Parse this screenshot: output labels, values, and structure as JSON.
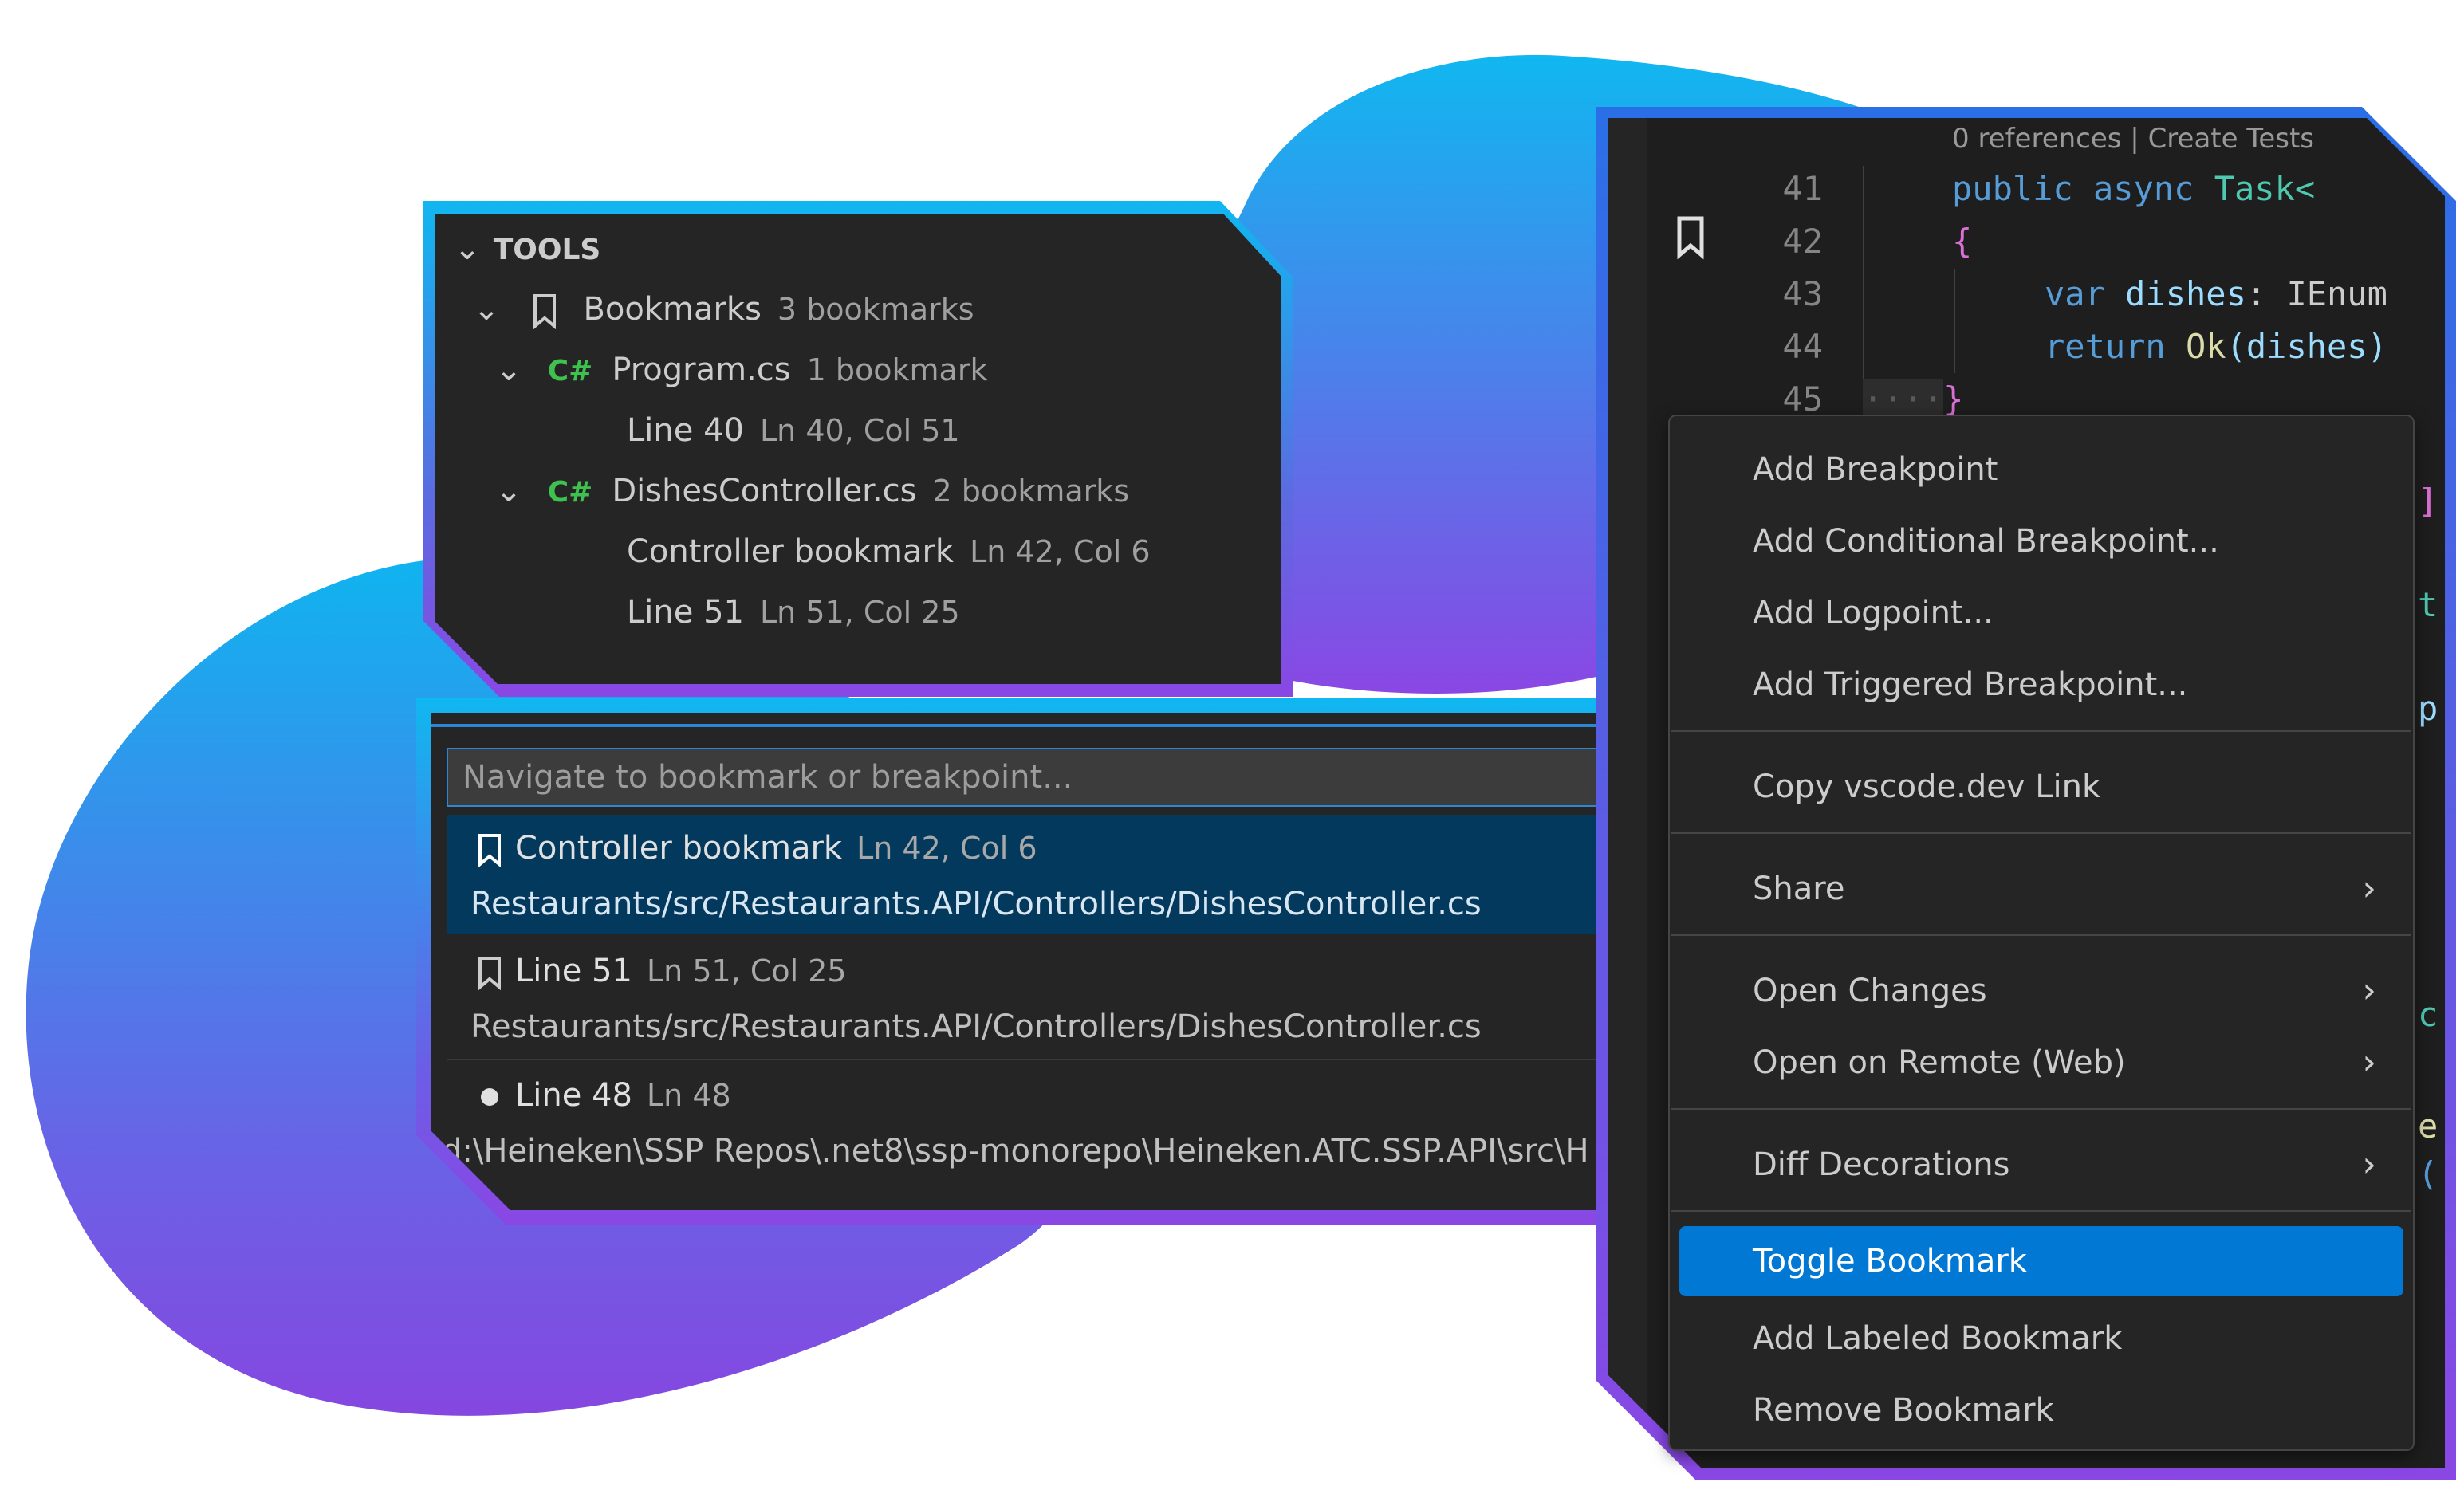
{
  "colors": {
    "accent": "#0078d4",
    "selected_row": "#04395e",
    "csharp_icon": "#3fc14f",
    "gradient_top": "#10b7f0",
    "gradient_bottom": "#8a47e4"
  },
  "tools_panel": {
    "header": "TOOLS",
    "bookmarks": {
      "label": "Bookmarks",
      "count": "3 bookmarks",
      "icon": "bookmark-icon"
    },
    "files": [
      {
        "icon": "C#",
        "name": "Program.cs",
        "count": "1 bookmark",
        "items": [
          {
            "label": "Line 40",
            "pos": "Ln 40, Col 51"
          }
        ]
      },
      {
        "icon": "C#",
        "name": "DishesController.cs",
        "count": "2 bookmarks",
        "items": [
          {
            "label": "Controller bookmark",
            "pos": "Ln 42, Col 6"
          },
          {
            "label": "Line 51",
            "pos": "Ln 51, Col 25"
          }
        ]
      }
    ]
  },
  "quick_pick": {
    "placeholder": "Navigate to bookmark or breakpoint...",
    "items": [
      {
        "icon": "bookmark-icon",
        "label": "Controller bookmark",
        "pos": "Ln 42, Col 6",
        "path": "Restaurants/src/Restaurants.API/Controllers/DishesController.cs",
        "selected": true
      },
      {
        "icon": "bookmark-icon",
        "label": "Line 51",
        "pos": "Ln 51, Col 25",
        "path": "Restaurants/src/Restaurants.API/Controllers/DishesController.cs",
        "selected": false
      },
      {
        "icon": "breakpoint-dot-icon",
        "label": "Line 48",
        "pos": "Ln 48",
        "path": "d:\\Heineken\\SSP Repos\\.net8\\ssp-monorepo\\Heineken.ATC.SSP.API\\src\\H",
        "selected": false
      }
    ]
  },
  "editor": {
    "codelens": "0 references | Create Tests",
    "lines": [
      {
        "number": "41",
        "kw": "public async ",
        "ty": "Task<"
      },
      {
        "number": "42",
        "brace": "{"
      },
      {
        "number": "43",
        "kw": "var ",
        "id": "dishes",
        "rest": ": IEnum"
      },
      {
        "number": "44",
        "kw": "return ",
        "fn": "Ok",
        "rest": "(dishes)"
      },
      {
        "number": "45",
        "brace": "}"
      }
    ]
  },
  "context_menu": {
    "items": [
      {
        "label": "Add Breakpoint"
      },
      {
        "label": "Add Conditional Breakpoint..."
      },
      {
        "label": "Add Logpoint..."
      },
      {
        "label": "Add Triggered Breakpoint..."
      },
      {
        "label": "Copy vscode.dev Link"
      },
      {
        "label": "Share",
        "submenu": true
      },
      {
        "label": "Open Changes",
        "submenu": true
      },
      {
        "label": "Open on Remote (Web)",
        "submenu": true
      },
      {
        "label": "Diff Decorations",
        "submenu": true
      },
      {
        "label": "Toggle Bookmark",
        "active": true
      },
      {
        "label": "Add Labeled Bookmark"
      },
      {
        "label": "Remove Bookmark"
      }
    ]
  }
}
